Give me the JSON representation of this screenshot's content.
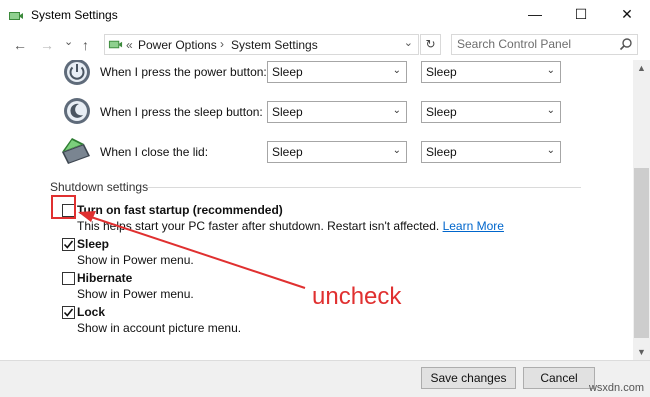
{
  "window": {
    "title": "System Settings",
    "minimize": "—",
    "maximize": "☐",
    "close": "✕"
  },
  "nav": {
    "back": "←",
    "forward": "→",
    "dropdown": "⌄",
    "up": "↑"
  },
  "address": {
    "overflow": "«",
    "crumbs": [
      "Power Options",
      "System Settings"
    ],
    "separator": "›",
    "dropdown": "⌄",
    "refresh": "↻"
  },
  "search": {
    "placeholder": "Search Control Panel"
  },
  "power_rows": [
    {
      "label": "When I press the power button:",
      "on_battery": "Sleep",
      "plugged_in": "Sleep"
    },
    {
      "label": "When I press the sleep button:",
      "on_battery": "Sleep",
      "plugged_in": "Sleep"
    },
    {
      "label": "When I close the lid:",
      "on_battery": "Sleep",
      "plugged_in": "Sleep"
    }
  ],
  "shutdown": {
    "title": "Shutdown settings",
    "options": [
      {
        "label": "Turn on fast startup (recommended)",
        "checked": false,
        "desc": "This helps start your PC faster after shutdown. Restart isn't affected.",
        "link": "Learn More"
      },
      {
        "label": "Sleep",
        "checked": true,
        "desc": "Show in Power menu."
      },
      {
        "label": "Hibernate",
        "checked": false,
        "desc": "Show in Power menu."
      },
      {
        "label": "Lock",
        "checked": true,
        "desc": "Show in account picture menu."
      }
    ]
  },
  "buttons": {
    "save": "Save changes",
    "cancel": "Cancel"
  },
  "annotation": {
    "text": "uncheck",
    "color": "#e03030"
  },
  "watermark": "wsxdn.com"
}
